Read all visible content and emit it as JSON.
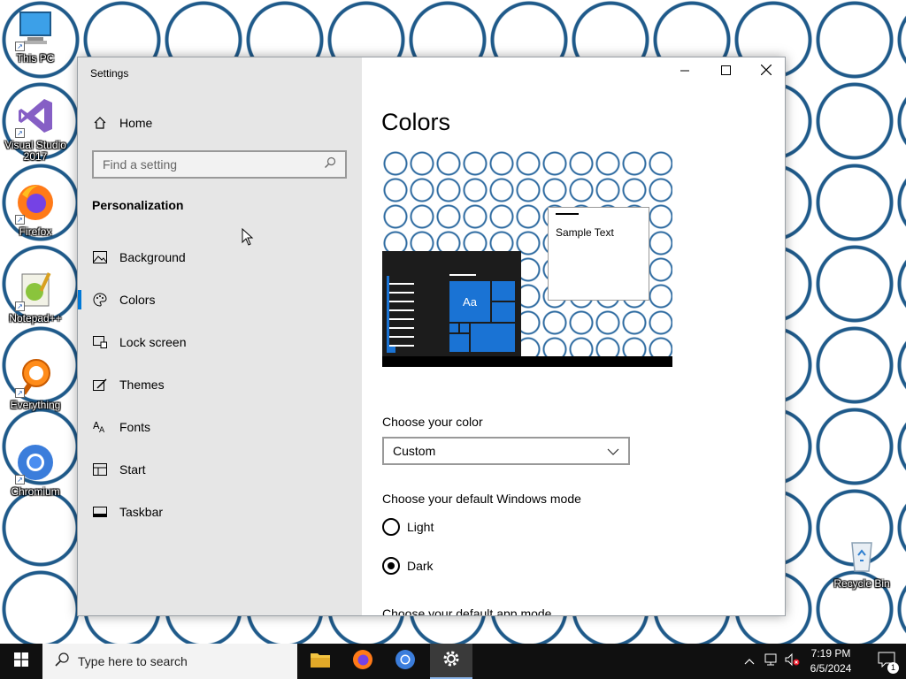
{
  "desktop": {
    "icons": [
      {
        "label": "This PC",
        "icon": "monitor-icon"
      },
      {
        "label": "Visual Studio 2017",
        "icon": "visual-studio-icon"
      },
      {
        "label": "Firefox",
        "icon": "firefox-icon"
      },
      {
        "label": "Notepad++",
        "icon": "notepadpp-icon"
      },
      {
        "label": "Everything",
        "icon": "everything-icon"
      },
      {
        "label": "Chromium",
        "icon": "chromium-icon"
      },
      {
        "label": "Recycle Bin",
        "icon": "recycle-bin-icon"
      }
    ]
  },
  "window": {
    "title": "Settings",
    "controls": {
      "minimize": "minimize-icon",
      "maximize": "maximize-icon",
      "close": "close-icon"
    }
  },
  "sidebar": {
    "home_label": "Home",
    "search_placeholder": "Find a setting",
    "section_heading": "Personalization",
    "items": [
      {
        "label": "Background",
        "icon": "picture-icon"
      },
      {
        "label": "Colors",
        "icon": "palette-icon",
        "active": true
      },
      {
        "label": "Lock screen",
        "icon": "lock-screen-icon"
      },
      {
        "label": "Themes",
        "icon": "brush-icon"
      },
      {
        "label": "Fonts",
        "icon": "font-icon"
      },
      {
        "label": "Start",
        "icon": "start-layout-icon"
      },
      {
        "label": "Taskbar",
        "icon": "taskbar-icon"
      }
    ]
  },
  "main": {
    "title": "Colors",
    "preview": {
      "sample_text": "Sample Text",
      "tile_text": "Aa"
    },
    "choose_color_label": "Choose your color",
    "choose_color_value": "Custom",
    "windows_mode_label": "Choose your default Windows mode",
    "windows_mode_options": [
      {
        "label": "Light",
        "checked": false
      },
      {
        "label": "Dark",
        "checked": true
      }
    ],
    "app_mode_label": "Choose your default app mode"
  },
  "taskbar": {
    "search_placeholder": "Type here to search",
    "apps": [
      "file-explorer-icon",
      "firefox-icon",
      "chromium-icon",
      "settings-icon"
    ],
    "clock": {
      "time": "7:19 PM",
      "date": "6/5/2024"
    },
    "notification_count": "1"
  },
  "colors": {
    "accent": "#0078d7",
    "sidebar_bg": "#e6e6e6",
    "taskbar_bg": "#101010"
  }
}
